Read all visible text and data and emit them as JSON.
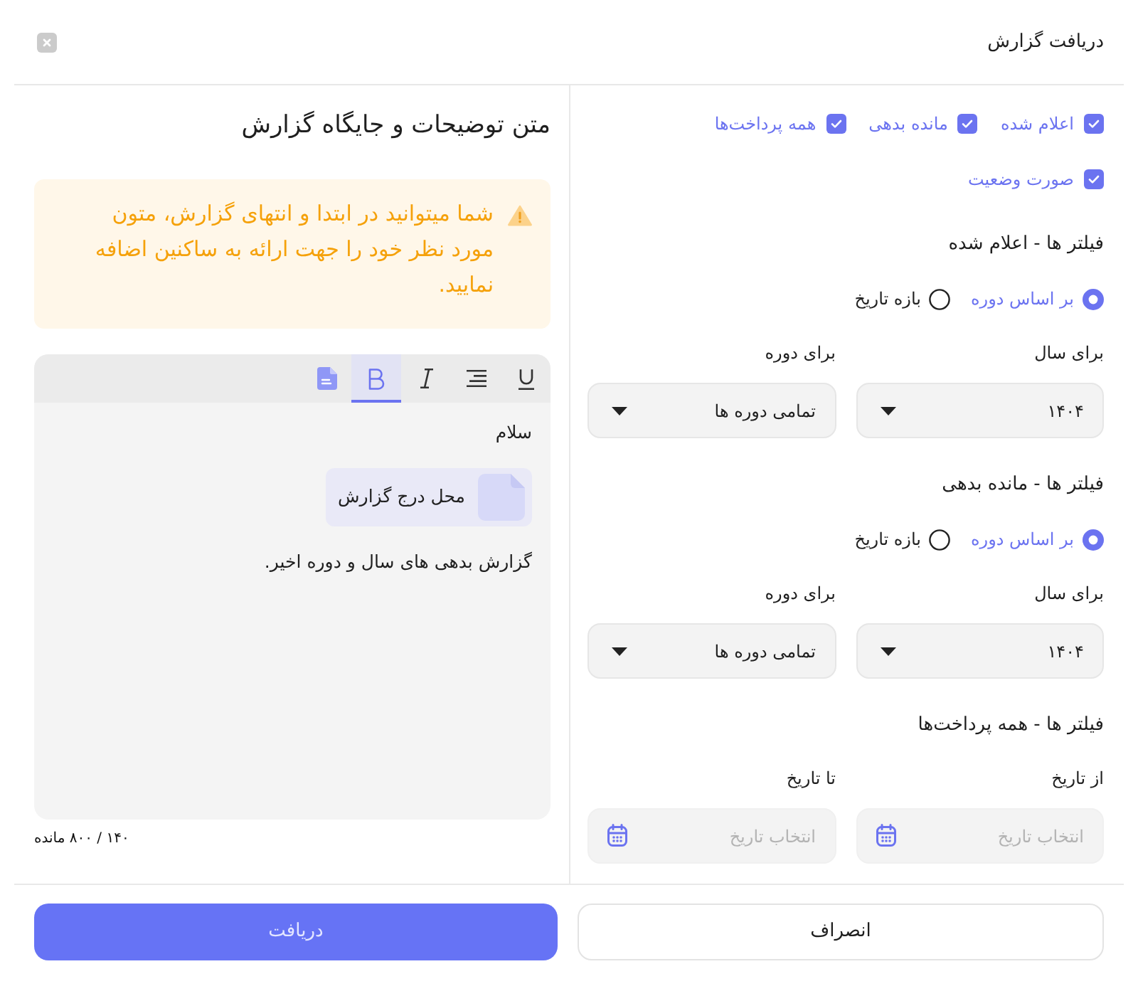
{
  "dialog": {
    "title": "دریافت گزارش"
  },
  "report_types": [
    {
      "label": "اعلام شده",
      "checked": true
    },
    {
      "label": "مانده بدهی",
      "checked": true
    },
    {
      "label": "همه پرداخت‌ها",
      "checked": true
    },
    {
      "label": "صورت وضعیت",
      "checked": true
    }
  ],
  "filters": [
    {
      "title": "فیلتر ها - اعلام شده",
      "modes": [
        {
          "label": "بر اساس دوره",
          "selected": true
        },
        {
          "label": "بازه تاریخ",
          "selected": false
        }
      ],
      "fields": [
        {
          "kind": "select",
          "label": "برای سال",
          "value": "۱۴۰۴"
        },
        {
          "kind": "select",
          "label": "برای دوره",
          "value": "تمامی دوره ها"
        }
      ]
    },
    {
      "title": "فیلتر ها - مانده بدهی",
      "modes": [
        {
          "label": "بر اساس دوره",
          "selected": true
        },
        {
          "label": "بازه تاریخ",
          "selected": false
        }
      ],
      "fields": [
        {
          "kind": "select",
          "label": "برای سال",
          "value": "۱۴۰۴"
        },
        {
          "kind": "select",
          "label": "برای دوره",
          "value": "تمامی دوره ها"
        }
      ]
    },
    {
      "title": "فیلتر ها - همه پرداخت‌ها",
      "fields": [
        {
          "kind": "date",
          "label": "از تاریخ",
          "placeholder": "انتخاب تاریخ"
        },
        {
          "kind": "date",
          "label": "تا تاریخ",
          "placeholder": "انتخاب تاریخ"
        }
      ]
    }
  ],
  "description": {
    "title": "متن توضیحات و جایگاه گزارش",
    "notice": "شما میتوانید در ابتدا و انتهای گزارش، متون مورد نظر خود را جهت ارائه به ساکنین اضافه نمایید.",
    "toolbar": [
      {
        "kind": "underline",
        "selected": false
      },
      {
        "kind": "align-right",
        "selected": false
      },
      {
        "kind": "italic",
        "selected": false
      },
      {
        "kind": "bold",
        "selected": true
      },
      {
        "kind": "insert-report",
        "selected": false
      }
    ],
    "content": [
      {
        "kind": "paragraph",
        "text": "سلام"
      },
      {
        "kind": "report-slot",
        "text": "محل درج گزارش"
      },
      {
        "kind": "paragraph",
        "text": "گزارش بدهی های سال و دوره اخیر."
      }
    ],
    "counter": "۱۴۰ / ۸۰۰ مانده"
  },
  "buttons": [
    {
      "kind": "secondary",
      "label": "انصراف"
    },
    {
      "kind": "primary",
      "label": "دریافت"
    }
  ]
}
